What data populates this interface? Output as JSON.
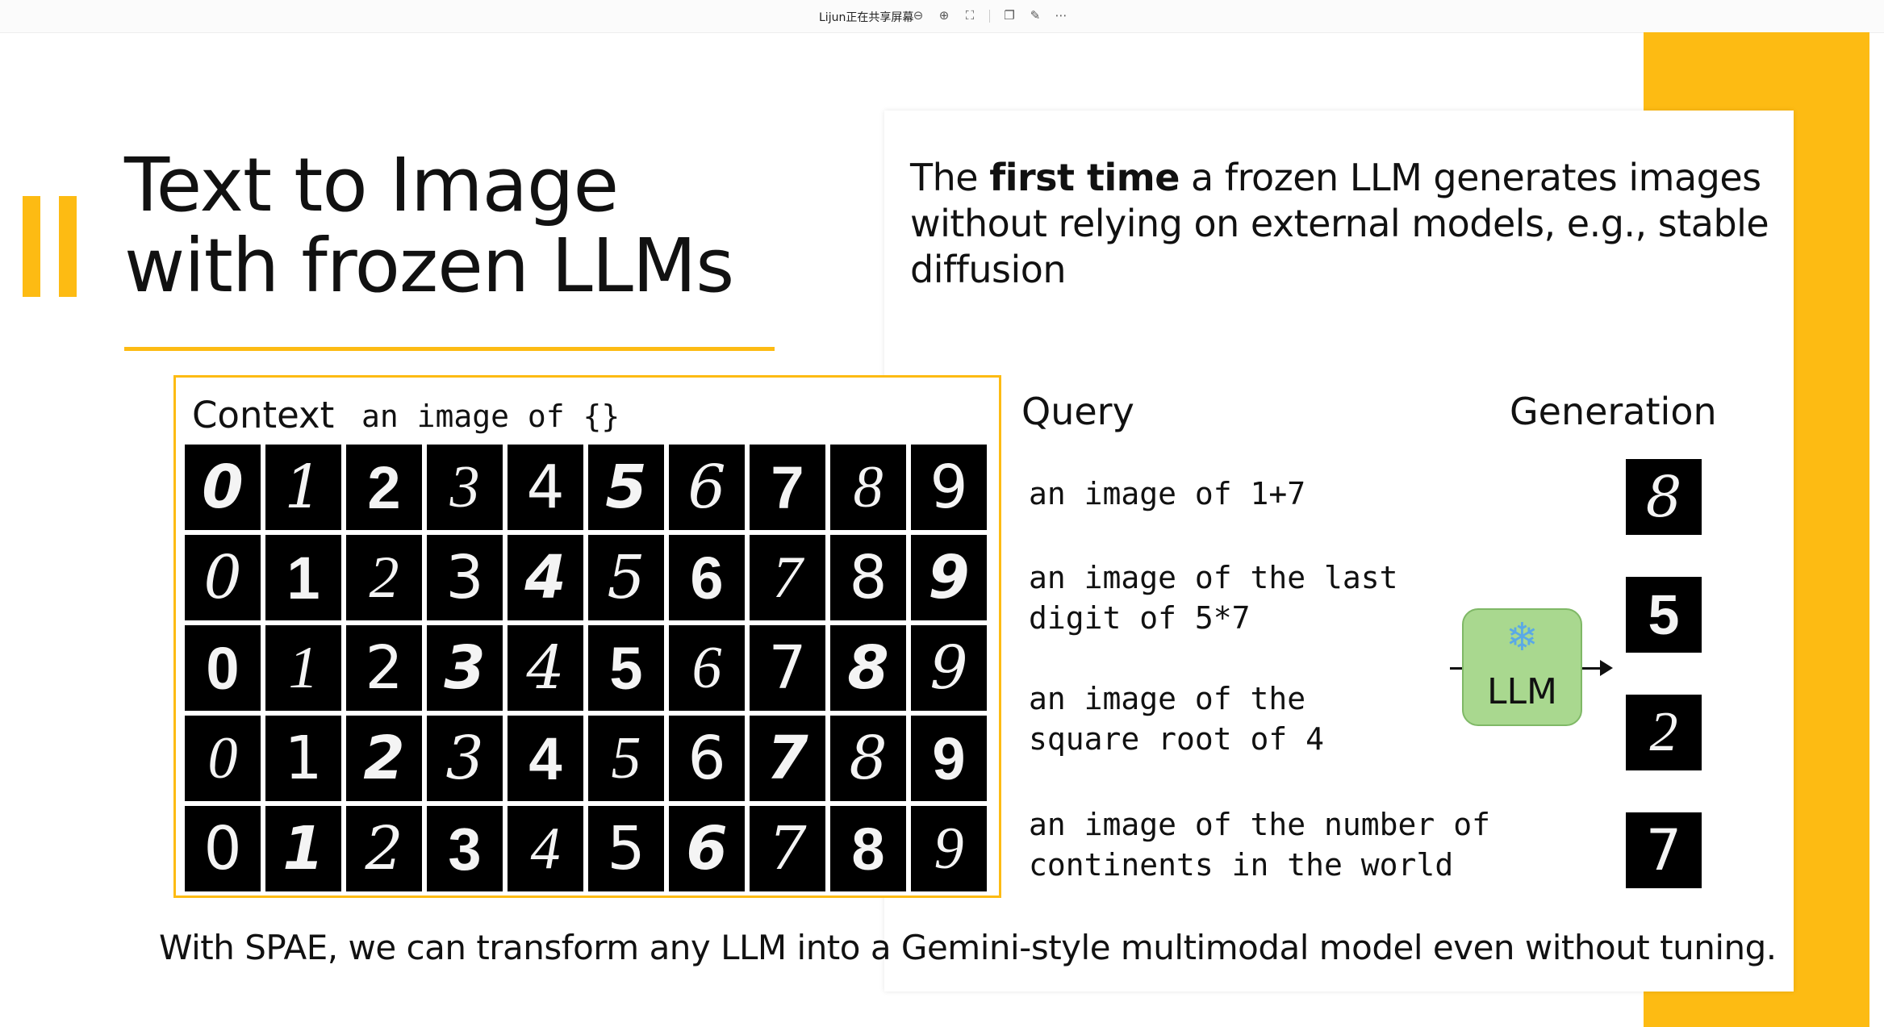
{
  "toolbar": {
    "share_label": "Lijun正在共享屏幕",
    "icons": [
      "zoom-out-icon",
      "zoom-in-icon",
      "fit-screen-icon",
      "popout-icon",
      "annotate-icon",
      "more-icon"
    ],
    "glyphs": {
      "zoom_out": "⊖",
      "zoom_in": "⊕",
      "fit": "⛶",
      "popout": "❐",
      "annotate": "✎",
      "more": "⋯"
    }
  },
  "slide": {
    "title_line1": "Text to Image",
    "title_line2": "with frozen LLMs",
    "desc_pre": "The ",
    "desc_bold": "first time",
    "desc_post": " a frozen LLM generates images without relying on external models, e.g., stable diffusion",
    "context_label": "Context",
    "context_template": "an image of {}",
    "context_digits": [
      [
        "0",
        "1",
        "2",
        "3",
        "4",
        "5",
        "6",
        "7",
        "8",
        "9"
      ],
      [
        "0",
        "1",
        "2",
        "3",
        "4",
        "5",
        "6",
        "7",
        "8",
        "9"
      ],
      [
        "0",
        "1",
        "2",
        "3",
        "4",
        "5",
        "6",
        "7",
        "8",
        "9"
      ],
      [
        "0",
        "1",
        "2",
        "3",
        "4",
        "5",
        "6",
        "7",
        "8",
        "9"
      ],
      [
        "0",
        "1",
        "2",
        "3",
        "4",
        "5",
        "6",
        "7",
        "8",
        "9"
      ]
    ],
    "query_header": "Query",
    "generation_header": "Generation",
    "queries": [
      "an image of 1+7",
      "an image of the last\ndigit of 5*7",
      "an image of the\nsquare root of 4",
      "an image of the number of\ncontinents in the world"
    ],
    "generations": [
      "8",
      "5",
      "2",
      "7"
    ],
    "llm_label": "LLM",
    "llm_icon": "snowflake-icon",
    "llm_glyph": "❄",
    "footer": "With SPAE, we can transform any LLM into a Gemini-style multimodal model even without tuning."
  },
  "colors": {
    "accent": "#fdbb13",
    "llm_fill": "#a9d88f",
    "snowflake": "#5aa9e6"
  }
}
